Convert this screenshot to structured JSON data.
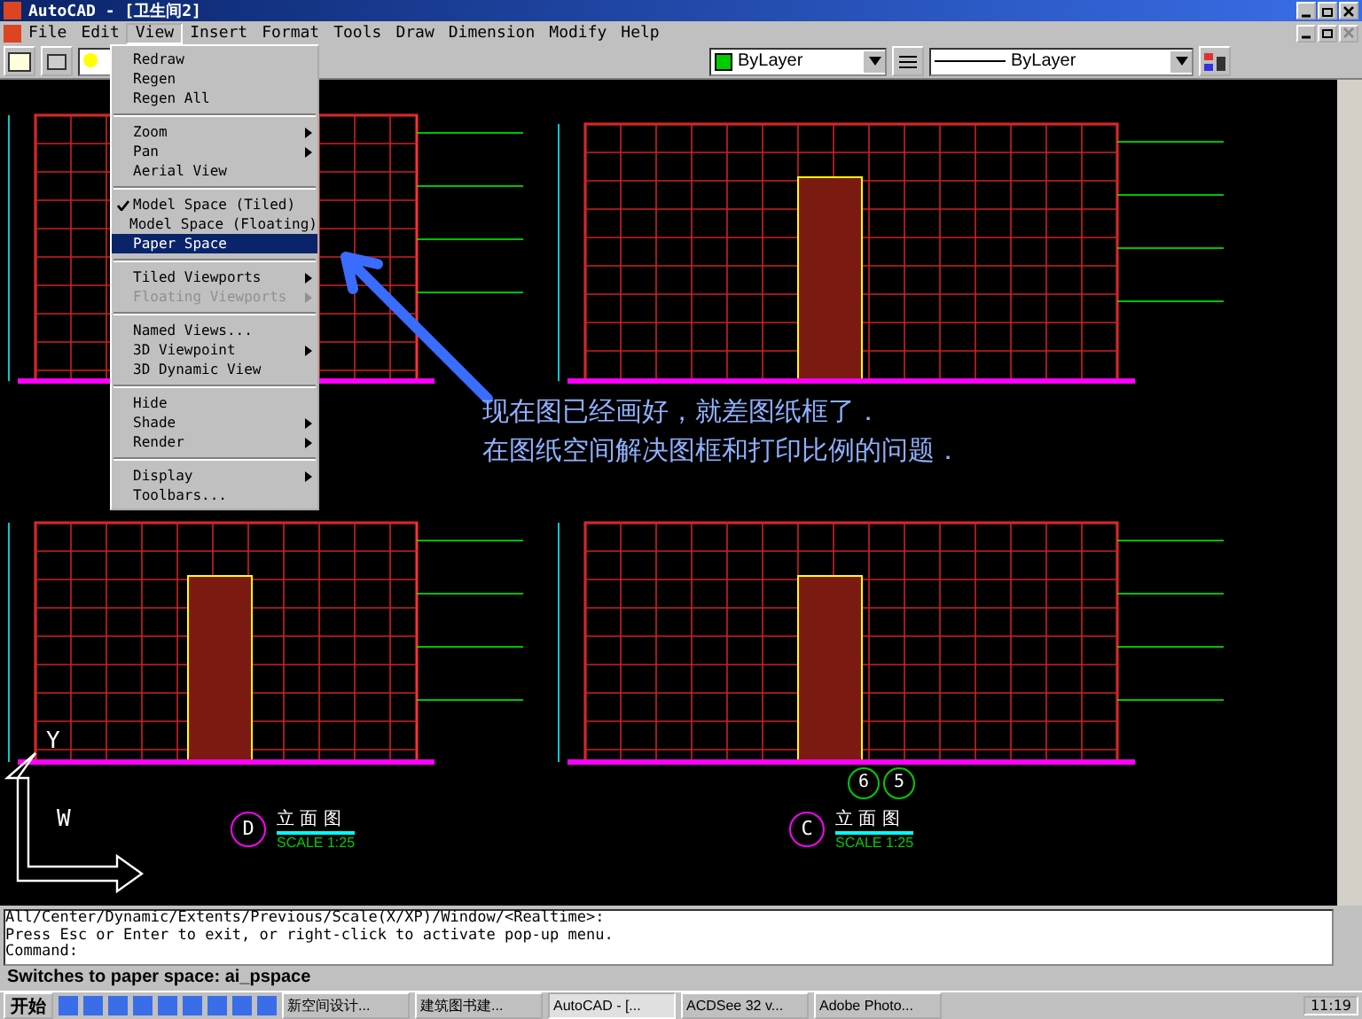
{
  "window": {
    "title": "AutoCAD - [卫生间2]"
  },
  "menu_bar": [
    {
      "label": "File",
      "selected": false
    },
    {
      "label": "Edit",
      "selected": false
    },
    {
      "label": "View",
      "selected": true
    },
    {
      "label": "Insert",
      "selected": false
    },
    {
      "label": "Format",
      "selected": false
    },
    {
      "label": "Tools",
      "selected": false
    },
    {
      "label": "Draw",
      "selected": false
    },
    {
      "label": "Dimension",
      "selected": false
    },
    {
      "label": "Modify",
      "selected": false
    },
    {
      "label": "Help",
      "selected": false
    }
  ],
  "toolbar": {
    "color_dropdown": "ByLayer",
    "linetype_dropdown": "ByLayer"
  },
  "view_menu": [
    {
      "kind": "item",
      "label": "Redraw",
      "checked": false,
      "disabled": false,
      "submenu": false,
      "selected": false
    },
    {
      "kind": "item",
      "label": "Regen",
      "checked": false,
      "disabled": false,
      "submenu": false,
      "selected": false
    },
    {
      "kind": "item",
      "label": "Regen All",
      "checked": false,
      "disabled": false,
      "submenu": false,
      "selected": false
    },
    {
      "kind": "separator"
    },
    {
      "kind": "item",
      "label": "Zoom",
      "checked": false,
      "disabled": false,
      "submenu": true,
      "selected": false
    },
    {
      "kind": "item",
      "label": "Pan",
      "checked": false,
      "disabled": false,
      "submenu": true,
      "selected": false
    },
    {
      "kind": "item",
      "label": "Aerial View",
      "checked": false,
      "disabled": false,
      "submenu": false,
      "selected": false
    },
    {
      "kind": "separator"
    },
    {
      "kind": "item",
      "label": "Model Space (Tiled)",
      "checked": true,
      "disabled": false,
      "submenu": false,
      "selected": false
    },
    {
      "kind": "item",
      "label": "Model Space (Floating)",
      "checked": false,
      "disabled": false,
      "submenu": false,
      "selected": false
    },
    {
      "kind": "item",
      "label": "Paper Space",
      "checked": false,
      "disabled": false,
      "submenu": false,
      "selected": true
    },
    {
      "kind": "separator"
    },
    {
      "kind": "item",
      "label": "Tiled Viewports",
      "checked": false,
      "disabled": false,
      "submenu": true,
      "selected": false
    },
    {
      "kind": "item",
      "label": "Floating Viewports",
      "checked": false,
      "disabled": true,
      "submenu": true,
      "selected": false
    },
    {
      "kind": "separator"
    },
    {
      "kind": "item",
      "label": "Named Views...",
      "checked": false,
      "disabled": false,
      "submenu": false,
      "selected": false
    },
    {
      "kind": "item",
      "label": "3D Viewpoint",
      "checked": false,
      "disabled": false,
      "submenu": true,
      "selected": false
    },
    {
      "kind": "item",
      "label": "3D Dynamic View",
      "checked": false,
      "disabled": false,
      "submenu": false,
      "selected": false
    },
    {
      "kind": "separator"
    },
    {
      "kind": "item",
      "label": "Hide",
      "checked": false,
      "disabled": false,
      "submenu": false,
      "selected": false
    },
    {
      "kind": "item",
      "label": "Shade",
      "checked": false,
      "disabled": false,
      "submenu": true,
      "selected": false
    },
    {
      "kind": "item",
      "label": "Render",
      "checked": false,
      "disabled": false,
      "submenu": true,
      "selected": false
    },
    {
      "kind": "separator"
    },
    {
      "kind": "item",
      "label": "Display",
      "checked": false,
      "disabled": false,
      "submenu": true,
      "selected": false
    },
    {
      "kind": "item",
      "label": "Toolbars...",
      "checked": false,
      "disabled": false,
      "submenu": false,
      "selected": false
    }
  ],
  "annotation": [
    "现在图已经画好，就差图纸框了．",
    "在图纸空间解决图框和打印比例的问题．"
  ],
  "drawing_titles": [
    {
      "marker": "D",
      "title": "立 面 图",
      "scale": "SCALE 1:25"
    },
    {
      "marker": "C",
      "title": "立 面 图",
      "scale": "SCALE 1:25"
    }
  ],
  "section_markers": [
    "6",
    "5"
  ],
  "ucs": {
    "y_label": "Y",
    "w_label": "W"
  },
  "command_lines": [
    "All/Center/Dynamic/Extents/Previous/Scale(X/XP)/Window/<Realtime>:",
    "Press Esc or Enter to exit, or right-click to activate pop-up menu.",
    "Command:"
  ],
  "status_bar": "Switches to paper space:  ai_pspace",
  "taskbar": {
    "start": "开始",
    "tasks": [
      {
        "label": "新空间设计...",
        "selected": false
      },
      {
        "label": "建筑图书建...",
        "selected": false
      },
      {
        "label": "AutoCAD - [...",
        "selected": true
      },
      {
        "label": "ACDSee 32 v...",
        "selected": false
      },
      {
        "label": "Adobe Photo...",
        "selected": false
      }
    ],
    "clock": "11:19"
  }
}
